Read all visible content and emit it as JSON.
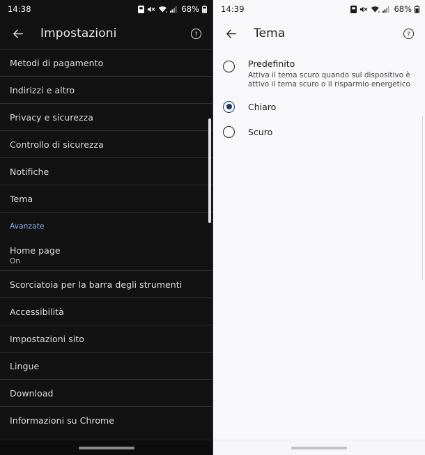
{
  "left_panel": {
    "status_bar": {
      "time": "14:38",
      "battery_percent": "68%",
      "icons": [
        "sim-card-icon",
        "mute-icon",
        "wifi-icon",
        "signal-icon",
        "battery-icon"
      ]
    },
    "app_bar": {
      "back_label": "back-arrow",
      "title": "Impostazioni",
      "help_label": "help"
    },
    "items": [
      {
        "title": "Metodi di pagamento",
        "type": "row"
      },
      {
        "title": "Indirizzi e altro",
        "type": "row"
      },
      {
        "title": "Privacy e sicurezza",
        "type": "row"
      },
      {
        "title": "Controllo di sicurezza",
        "type": "row"
      },
      {
        "title": "Notifiche",
        "type": "row"
      },
      {
        "title": "Tema",
        "type": "row"
      },
      {
        "title": "Avanzate",
        "type": "section"
      },
      {
        "title": "Home page",
        "subtitle": "On",
        "type": "row-two-line"
      },
      {
        "title": "Scorciatoia per la barra degli strumenti",
        "type": "row"
      },
      {
        "title": "Accessibilità",
        "type": "row"
      },
      {
        "title": "Impostazioni sito",
        "type": "row"
      },
      {
        "title": "Lingue",
        "type": "row"
      },
      {
        "title": "Download",
        "type": "row"
      },
      {
        "title": "Informazioni su Chrome",
        "type": "row"
      }
    ]
  },
  "right_panel": {
    "status_bar": {
      "time": "14:39",
      "battery_percent": "68%",
      "icons": [
        "sim-card-icon",
        "mute-icon",
        "wifi-icon",
        "signal-icon",
        "battery-icon"
      ]
    },
    "app_bar": {
      "back_label": "back-arrow",
      "title": "Tema",
      "help_label": "help"
    },
    "options": [
      {
        "label": "Predefinito",
        "description": "Attiva il tema scuro quando sul dispositivo è attivo il tema scuro o il risparmio energetico",
        "selected": false
      },
      {
        "label": "Chiaro",
        "description": "",
        "selected": true
      },
      {
        "label": "Scuro",
        "description": "",
        "selected": false
      }
    ]
  },
  "colors": {
    "dark_bg": "#121212",
    "dark_text": "#dcdcdc",
    "section_accent": "#8ab4f8",
    "light_bg": "#f8f7fa",
    "light_text": "#1f1f1f",
    "radio_selected": "#1a3a66",
    "divider_dark": "#323234"
  }
}
